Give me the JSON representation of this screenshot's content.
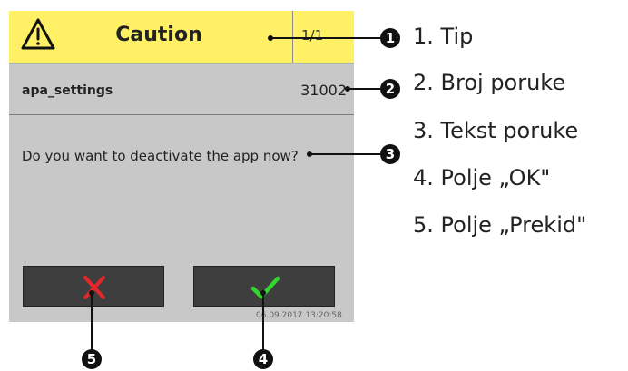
{
  "dialog": {
    "icon": "warning-triangle-icon",
    "title": "Caution",
    "counter": "1/1",
    "source": "apa_settings",
    "message_number": "31002",
    "message": "Do you want to deactivate the app now?",
    "cancel_icon": "close-x-icon",
    "ok_icon": "checkmark-icon",
    "timestamp": "06.09.2017 13:20:58",
    "colors": {
      "header": "#fff065",
      "body": "#c8c8c8",
      "button": "#3e3e3e",
      "cancel": "#e3272a",
      "ok": "#33d62c"
    }
  },
  "callouts": [
    "1",
    "2",
    "3",
    "4",
    "5"
  ],
  "legend": [
    "1.  Tip",
    "2.  Broj poruke",
    "3.  Tekst poruke",
    "4.  Polje „OK\"",
    "5.  Polje „Prekid\""
  ]
}
